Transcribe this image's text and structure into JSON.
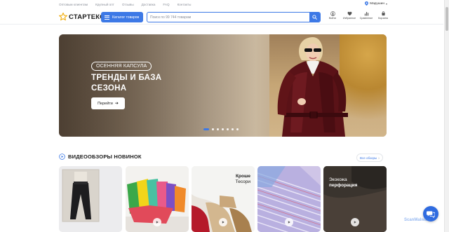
{
  "topbar": {
    "links": [
      "Оптовым клиентам",
      "Крупный опт",
      "Отзывы",
      "Доставка",
      "FAQ",
      "Контакты"
    ],
    "city": "Марушин"
  },
  "header": {
    "logo_text": "СТАРТЕКС",
    "catalog_label": "Каталог товаров",
    "search_placeholder": "Поиск по 99 744 товарам",
    "icons": [
      {
        "icon": "user-icon",
        "label": "Войти"
      },
      {
        "icon": "heart-icon",
        "label": "Избранное"
      },
      {
        "icon": "compare-icon",
        "label": "Сравнение"
      },
      {
        "icon": "cart-icon",
        "label": "Корзина"
      }
    ]
  },
  "hero": {
    "capsule": "ОСЕННЯЯ КАПСУЛА",
    "title_line1": "ТРЕНДЫ И БАЗА",
    "title_line2": "СЕЗОНА",
    "button": "Перейти",
    "slides_total": 7,
    "active_slide": 1
  },
  "section": {
    "title": "ВИДЕООБЗОРЫ НОВИНОК",
    "all_link": "Все обзоры"
  },
  "cards": [
    {
      "title": "",
      "subtitle": ""
    },
    {
      "title": "",
      "subtitle": ""
    },
    {
      "title": "Кроше",
      "subtitle": "Тесори"
    },
    {
      "title": "",
      "subtitle": ""
    },
    {
      "title": "Экокожа",
      "subtitle": "перфорация"
    }
  ],
  "watermark": "ScanMalware",
  "colors": {
    "accent": "#3d79e6"
  }
}
